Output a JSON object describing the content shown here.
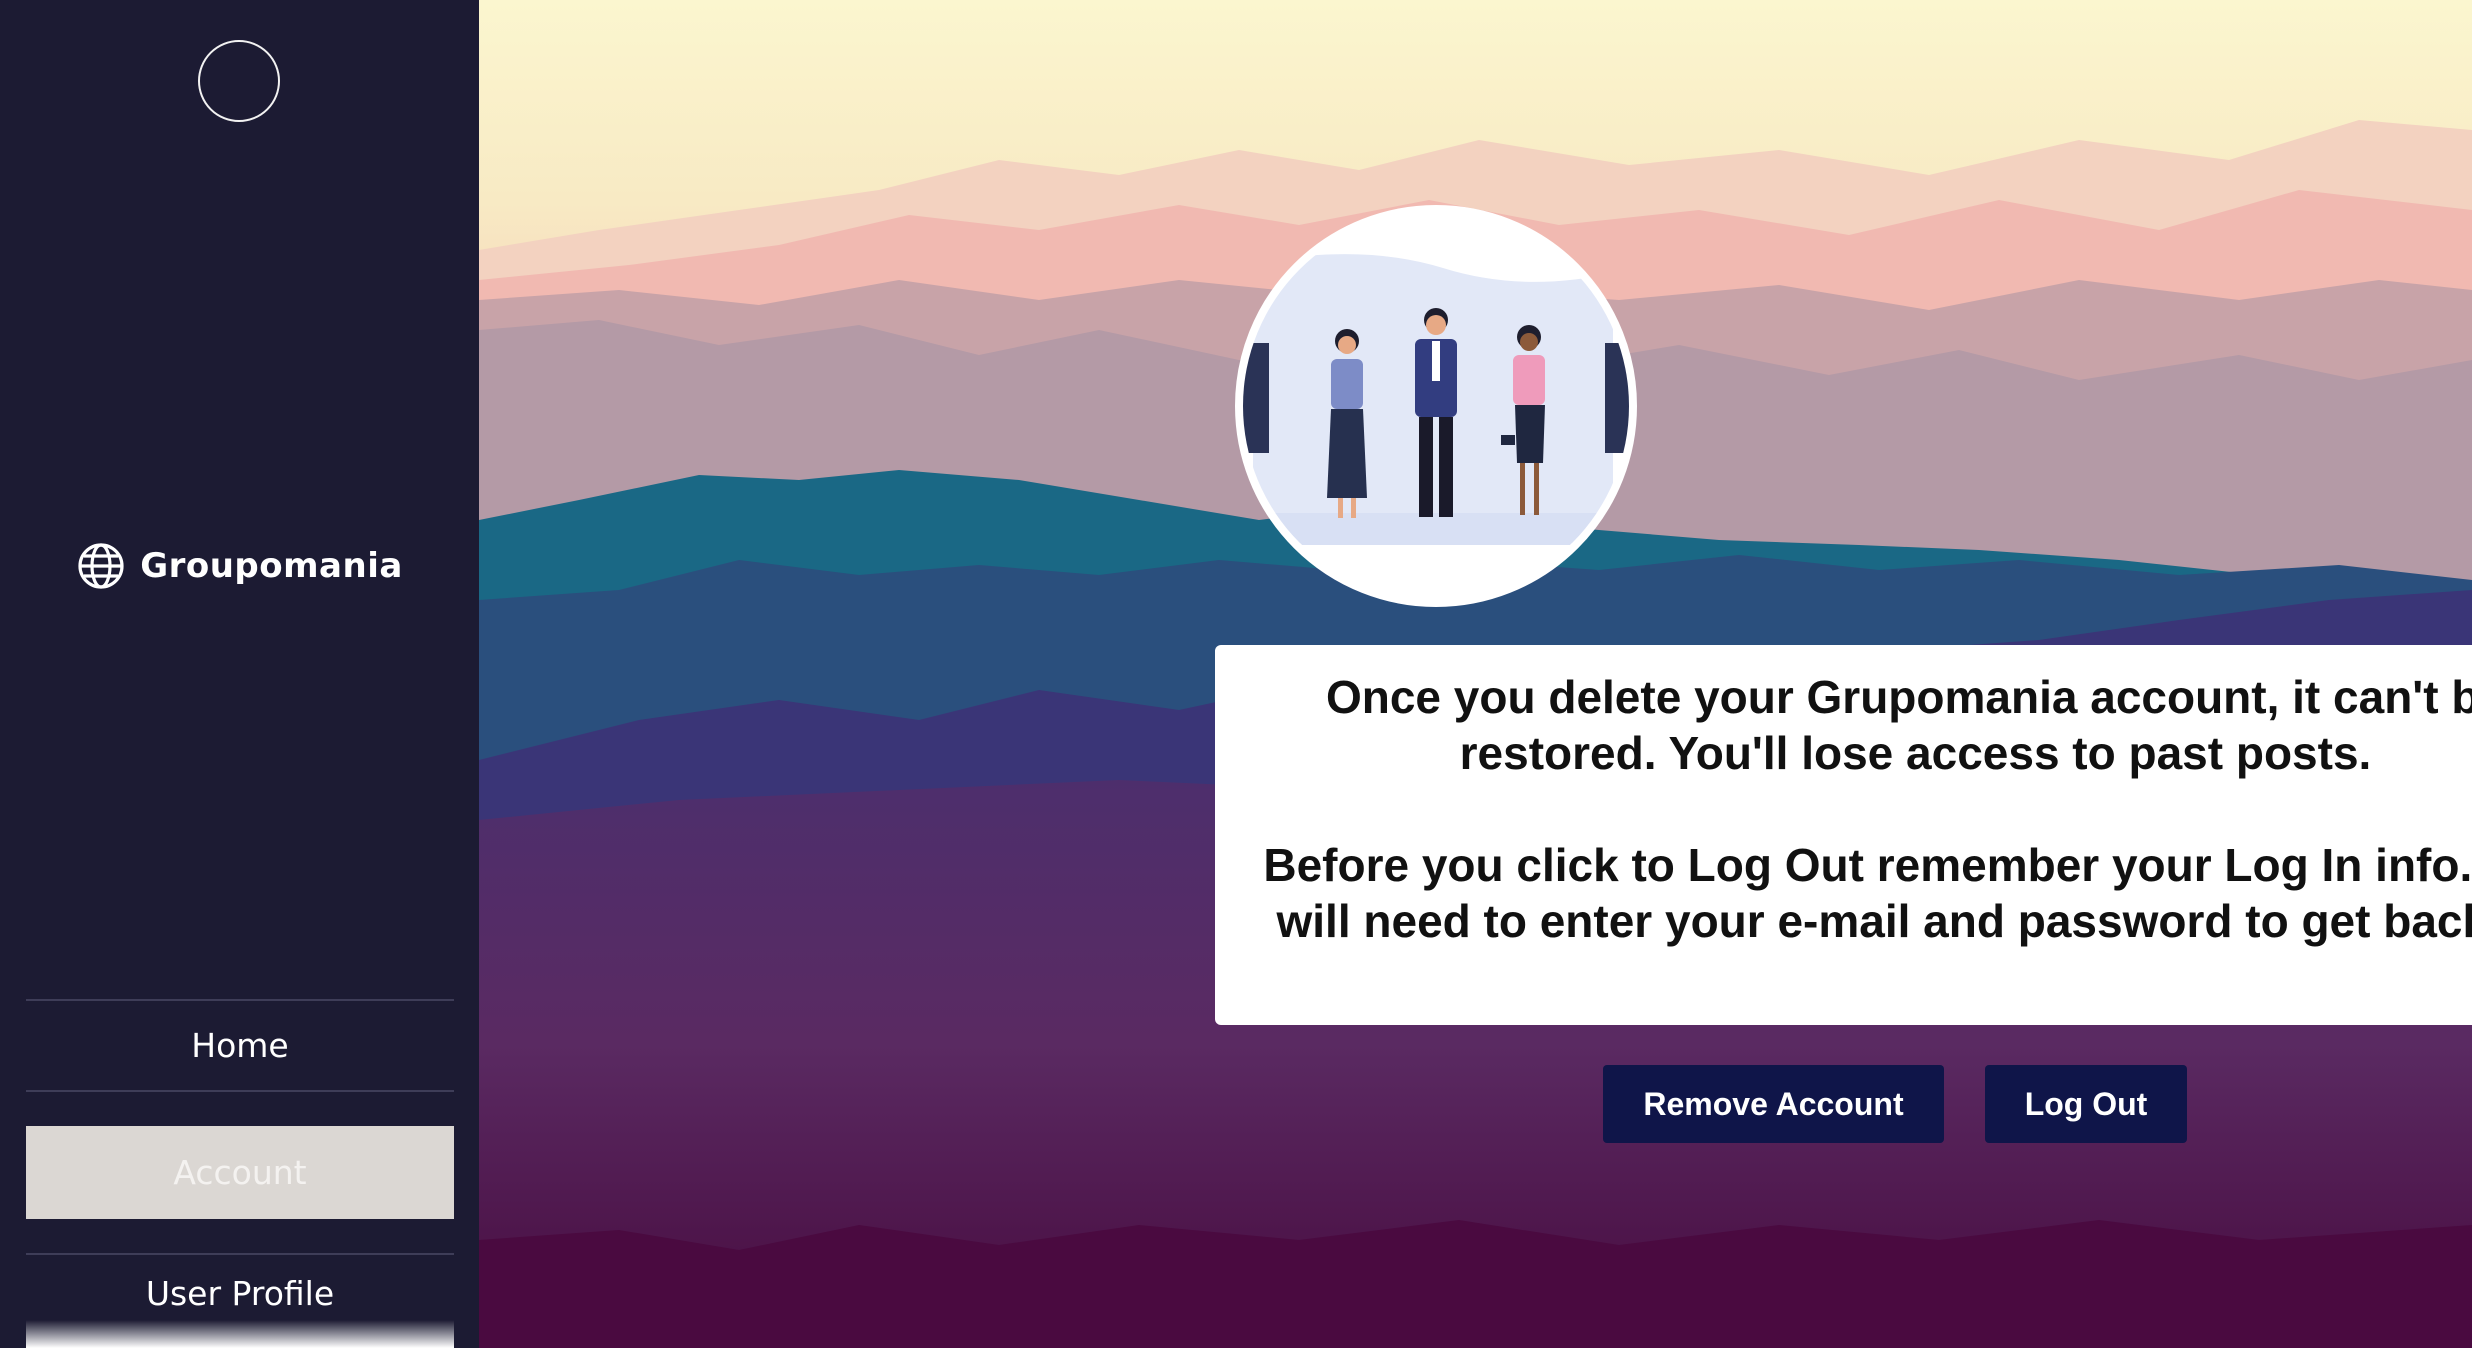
{
  "brand": {
    "name": "Groupomania",
    "icon": "globe-icon"
  },
  "sidebar": {
    "items": [
      {
        "label": "Home",
        "active": false
      },
      {
        "label": "Account",
        "active": true
      },
      {
        "label": "User Profile",
        "active": false
      }
    ]
  },
  "main": {
    "message": {
      "line1": "Once you delete your Grupomania account, it can't be restored. You'll lose access to past posts.",
      "line2": "Before you click to Log Out remember your Log In info. You will need to enter your e-mail and password to get back in."
    },
    "buttons": {
      "remove_label": "Remove Account",
      "logout_label": "Log Out"
    }
  },
  "colors": {
    "sidebar_bg": "#1c1b33",
    "button_bg": "#0f1549",
    "active_nav_bg": "#dbd7d3",
    "card_bg": "#ffffff"
  }
}
